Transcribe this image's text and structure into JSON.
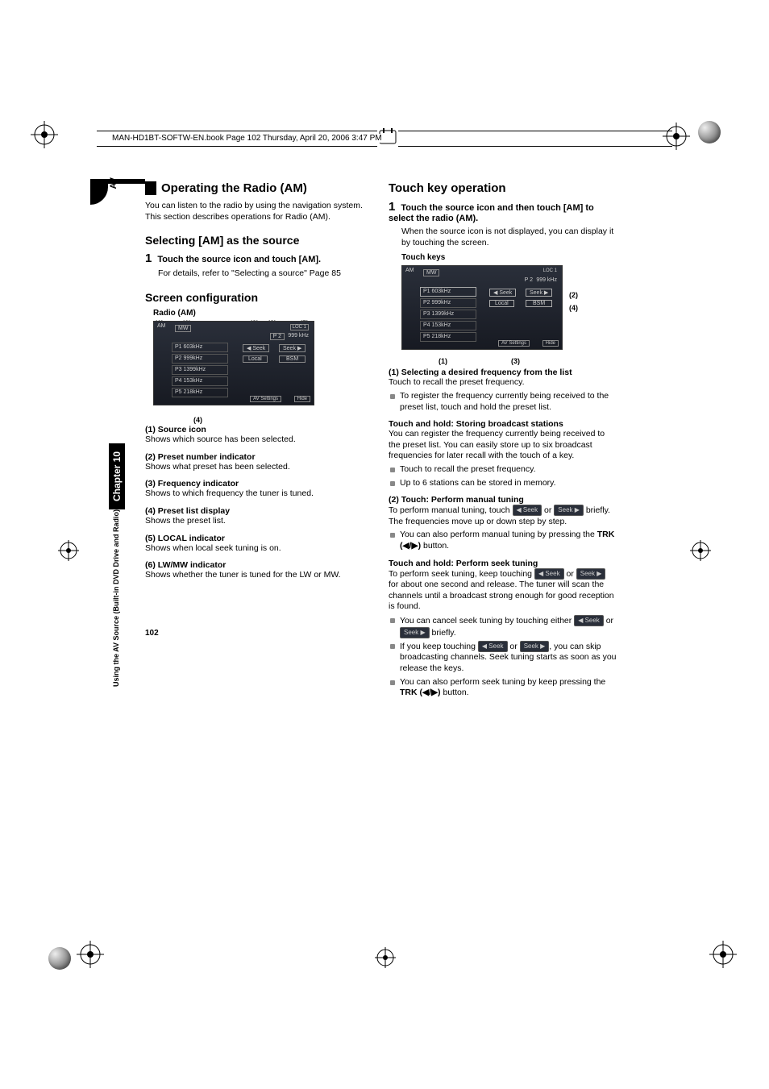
{
  "header": {
    "filepath": "MAN-HD1BT-SOFTW-EN.book  Page 102  Thursday, April 20, 2006  3:47 PM"
  },
  "sidetab": {
    "av": "AV",
    "chapter": "Chapter 10",
    "long": "Using the AV Source (Built-in DVD Drive and Radio)"
  },
  "page_number": "102",
  "left": {
    "title": "Operating the Radio (AM)",
    "intro": "You can listen to the radio by using the navigation system. This section describes operations for Radio (AM).",
    "subhead1": "Selecting [AM] as the source",
    "step1_bold": "Touch the source icon and touch [AM].",
    "step1_detail": "For details, refer to \"Selecting a source\" Page 85",
    "subhead2": "Screen configuration",
    "fig_label": "Radio (AM)",
    "markers": {
      "m1": "(1)",
      "m2": "(2)",
      "m3": "(3)",
      "m4": "(4)",
      "m5": "(5)",
      "m6": "(6)"
    },
    "items": {
      "i1_t": "(1) Source icon",
      "i1_b": "Shows which source has been selected.",
      "i2_t": "(2) Preset number indicator",
      "i2_b": "Shows what preset has been selected.",
      "i3_t": "(3) Frequency indicator",
      "i3_b": "Shows to which frequency the tuner is tuned.",
      "i4_t": "(4) Preset list display",
      "i4_b": "Shows the preset list.",
      "i5_t": "(5) LOCAL indicator",
      "i5_b": "Shows when local seek tuning is on.",
      "i6_t": "(6) LW/MW indicator",
      "i6_b": "Shows whether the tuner is tuned for the LW or MW."
    },
    "fig_rows": {
      "band": "MW",
      "preset": "P 2",
      "freq": "999  kHz",
      "local": "LOC 1",
      "p1": "P1    603kHz",
      "p2": "P2    999kHz",
      "p3": "P3  1399kHz",
      "p4": "P4    153kHz",
      "p5": "P5    218kHz",
      "seek_l": "◀   Seek",
      "seek_r": "Seek   ▶",
      "local_btn": "Local",
      "bsm": "BSM",
      "av_settings": "AV Settings",
      "hide": "Hide"
    }
  },
  "right": {
    "title": "Touch key operation",
    "step1_bold": "Touch the source icon and then touch [AM] to select the radio (AM).",
    "step1_body": "When the source icon is not displayed, you can display it by touching the screen.",
    "touch_keys": "Touch keys",
    "markers": {
      "m1": "(1)",
      "m2": "(2)",
      "m3": "(3)",
      "m4": "(4)"
    },
    "h1": "(1) Selecting a desired frequency from the list",
    "h1_body": "Touch to recall the preset frequency.",
    "h1_bul": "To register the frequency currently being received to the preset list, touch and hold the preset list.",
    "h2": "Touch and hold: Storing broadcast stations",
    "h2_body": "You can register the frequency currently being received to the preset list. You can easily store up to six broadcast frequencies for later recall with the touch of a key.",
    "h2_bul1": "Touch to recall the preset frequency.",
    "h2_bul2": "Up to 6 stations can be stored in memory.",
    "h3": "(2) Touch: Perform manual tuning",
    "h3_body1": "To perform manual tuning, touch ",
    "h3_body2": " or ",
    "h3_body3": " briefly. The frequencies move up or down step by step.",
    "h3_bul_a": "You can also perform manual tuning by pressing the ",
    "h3_bul_b": " button.",
    "trk": "TRK (◀/▶)",
    "h4": "Touch and hold: Perform seek tuning",
    "h4_body1": "To perform seek tuning, keep touching ",
    "h4_body2": " or ",
    "h4_body3": " for about one second and release. The tuner will scan the channels until a broadcast strong enough for good reception is found.",
    "h4_bul1a": "You can cancel seek tuning by touching either ",
    "h4_bul1b": " or ",
    "h4_bul1c": " briefly.",
    "h4_bul2a": "If you keep touching ",
    "h4_bul2b": " or ",
    "h4_bul2c": ", you can skip broadcasting channels. Seek tuning starts as soon as you release the keys.",
    "h4_bul3a": "You can also perform seek tuning by keep pressing the ",
    "h4_bul3b": " button.",
    "seek_l": "◀  Seek",
    "seek_r": "Seek  ▶"
  }
}
